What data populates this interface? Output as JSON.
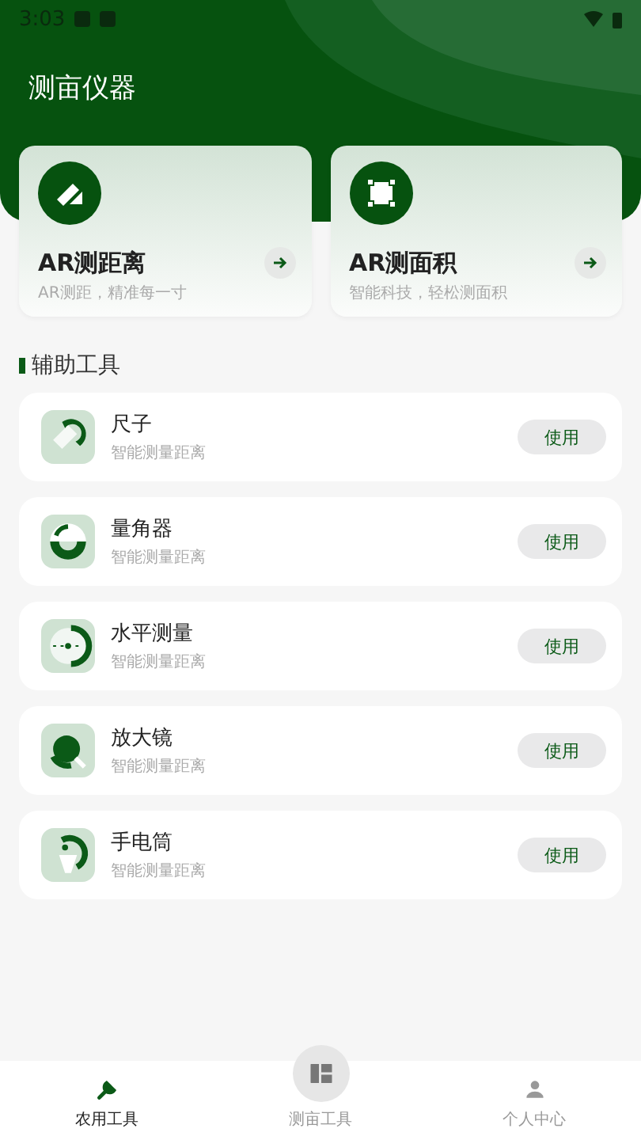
{
  "status_bar": {
    "time": "3:03"
  },
  "header": {
    "title": "测亩仪器"
  },
  "feature_cards": [
    {
      "title": "AR测距离",
      "subtitle": "AR测距，精准每一寸"
    },
    {
      "title": "AR测面积",
      "subtitle": "智能科技，轻松测面积"
    }
  ],
  "section": {
    "title": "辅助工具"
  },
  "tools": [
    {
      "name": "尺子",
      "description": "智能测量距离",
      "button": "使用"
    },
    {
      "name": "量角器",
      "description": "智能测量距离",
      "button": "使用"
    },
    {
      "name": "水平测量",
      "description": "智能测量距离",
      "button": "使用"
    },
    {
      "name": "放大镜",
      "description": "智能测量距离",
      "button": "使用"
    },
    {
      "name": "手电筒",
      "description": "智能测量距离",
      "button": "使用"
    }
  ],
  "bottom_nav": [
    {
      "label": "农用工具",
      "selected": true
    },
    {
      "label": "测亩工具",
      "selected": false
    },
    {
      "label": "个人中心",
      "selected": false
    }
  ]
}
